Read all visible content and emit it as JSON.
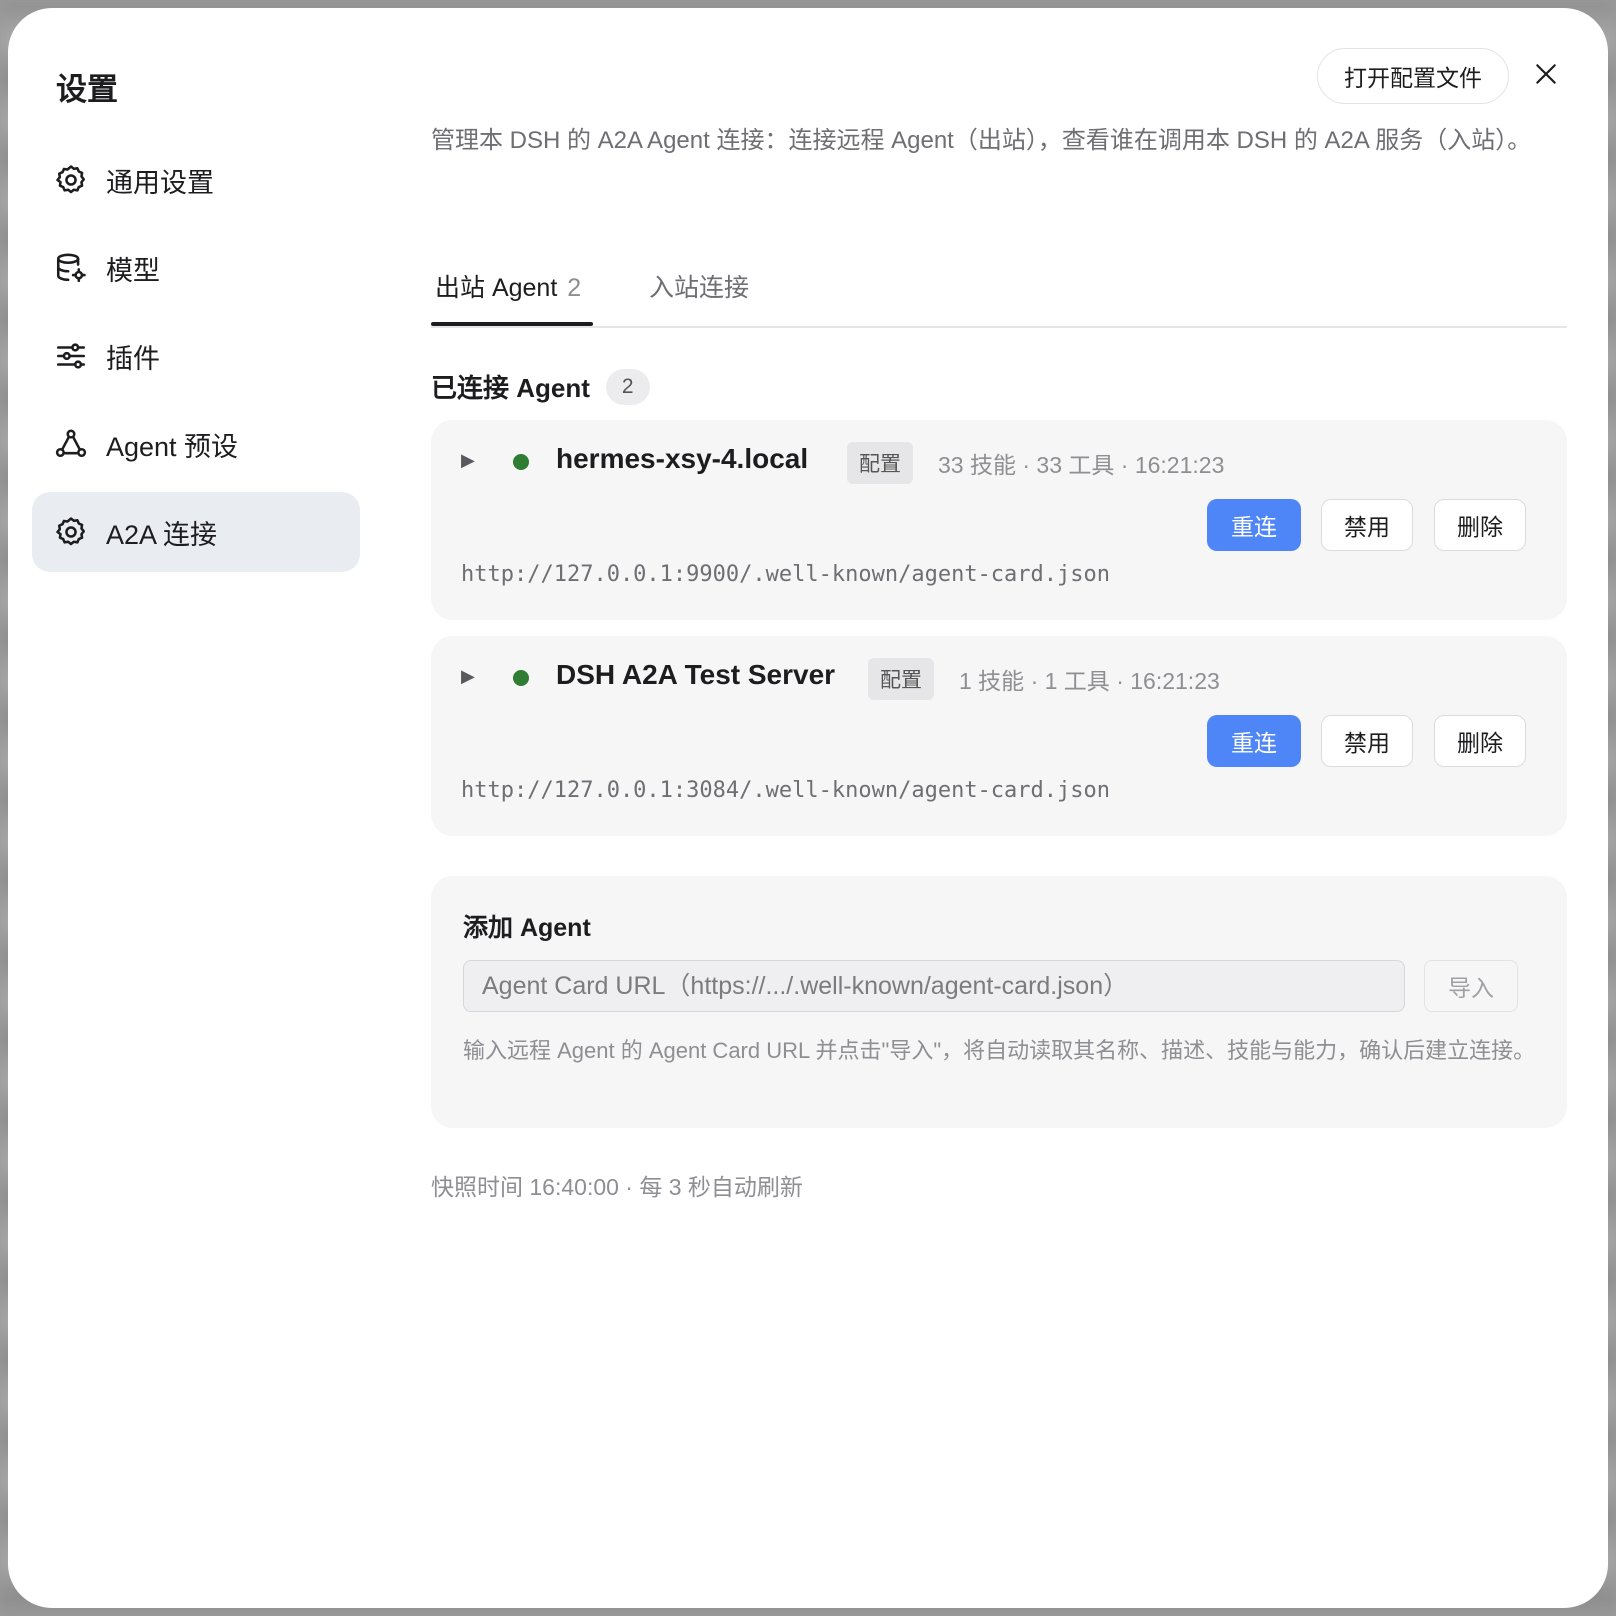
{
  "dialog": {
    "title": "设置",
    "open_config_label": "打开配置文件",
    "close_icon": "close-icon"
  },
  "sidebar": {
    "items": [
      {
        "label": "通用设置",
        "icon": "gear-icon",
        "active": false
      },
      {
        "label": "模型",
        "icon": "database-gear-icon",
        "active": false
      },
      {
        "label": "插件",
        "icon": "sliders-icon",
        "active": false
      },
      {
        "label": "Agent 预设",
        "icon": "agent-network-icon",
        "active": false
      },
      {
        "label": "A2A 连接",
        "icon": "gear-icon",
        "active": true
      }
    ]
  },
  "main": {
    "description": "管理本 DSH 的 A2A Agent 连接：连接远程 Agent（出站），查看谁在调用本 DSH 的 A2A 服务（入站）。",
    "tabs": [
      {
        "label": "出站 Agent",
        "count": "2",
        "active": true
      },
      {
        "label": "入站连接",
        "count": "",
        "active": false
      }
    ],
    "connected_title": "已连接 Agent",
    "connected_count": "2",
    "agents": [
      {
        "name": "hermes-xsy-4.local",
        "tag": "配置",
        "meta": "33 技能 · 33 工具 · 16:21:23",
        "url": "http://127.0.0.1:9900/.well-known/agent-card.json",
        "status_color": "#2e7d32",
        "reconnect_label": "重连",
        "disable_label": "禁用",
        "delete_label": "删除"
      },
      {
        "name": "DSH A2A Test Server",
        "tag": "配置",
        "meta": "1 技能 · 1 工具 · 16:21:23",
        "url": "http://127.0.0.1:3084/.well-known/agent-card.json",
        "status_color": "#2e7d32",
        "reconnect_label": "重连",
        "disable_label": "禁用",
        "delete_label": "删除"
      }
    ],
    "add_agent": {
      "title": "添加 Agent",
      "input_value": "",
      "input_placeholder": "Agent Card URL（https://.../.well-known/agent-card.json）",
      "import_label": "导入",
      "help_text": "输入远程 Agent 的 Agent Card URL 并点击\"导入\"，将自动读取其名称、描述、技能与能力，确认后建立连接。"
    },
    "footer": "快照时间 16:40:00 · 每 3 秒自动刷新"
  },
  "colors": {
    "accent": "#4f86f7",
    "status_online": "#2e7d32",
    "active_nav_bg": "#e9edf2"
  }
}
